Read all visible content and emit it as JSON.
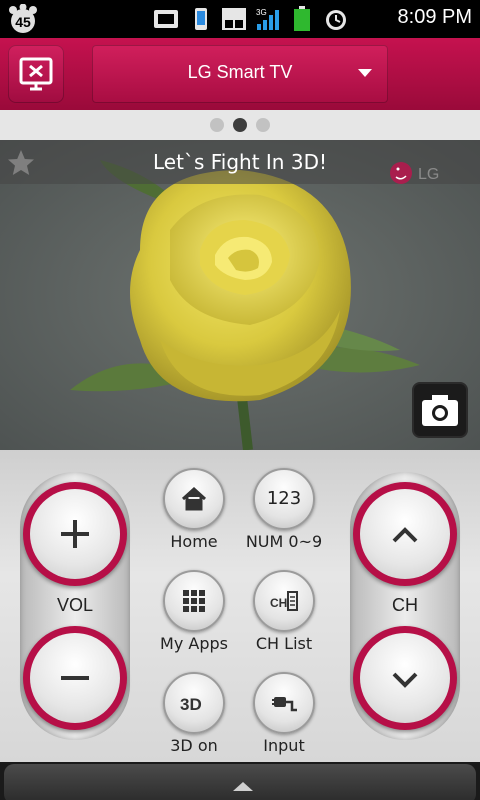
{
  "status_bar": {
    "badge_count": "45",
    "network": "3G",
    "time": "8:09 PM"
  },
  "header": {
    "device_name": "LG Smart TV"
  },
  "pager": {
    "pages": 3,
    "active_index": 1
  },
  "preview": {
    "title": "Let`s Fight In 3D!",
    "logo_text": "LG"
  },
  "remote": {
    "vol_label": "VOL",
    "ch_label": "CH",
    "buttons": {
      "home": "Home",
      "num": "NUM 0~9",
      "num_icon_text": "123",
      "apps": "My Apps",
      "chlist": "CH List",
      "threed": "3D on",
      "input": "Input"
    }
  },
  "colors": {
    "accent": "#b60f47",
    "panel": "#d9d9d9"
  }
}
